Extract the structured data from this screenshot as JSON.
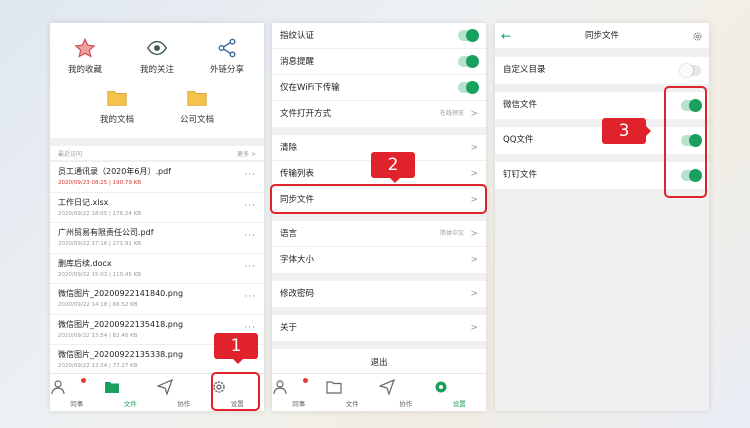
{
  "phone1": {
    "quick_items": [
      {
        "label": "我的收藏",
        "icon": "star-icon"
      },
      {
        "label": "我的关注",
        "icon": "eye-icon"
      },
      {
        "label": "外链分享",
        "icon": "share-icon"
      },
      {
        "label": "我的文档",
        "icon": "folder-icon"
      },
      {
        "label": "公司文档",
        "icon": "folder-icon"
      }
    ],
    "recent_title": "最近访问",
    "more_label": "更多 >",
    "files": [
      {
        "name": "员工通讯录（2020年6月）.pdf",
        "meta": "2020/09/23 08:25 | 190.79 KB",
        "highlight": true
      },
      {
        "name": "工作日记.xlsx",
        "meta": "2020/09/22 18:05 | 176.24 KB",
        "highlight": false
      },
      {
        "name": "广州贸易有限责任公司.pdf",
        "meta": "2020/09/22 17:16 | 271.91 KB",
        "highlight": false
      },
      {
        "name": "删库后续.docx",
        "meta": "2020/09/22 15:03 | 110.45 KB",
        "highlight": false
      },
      {
        "name": "微信图片_20200922141840.png",
        "meta": "2020/09/22 14:18 | 66.52 KB",
        "highlight": false
      },
      {
        "name": "微信图片_20200922135418.png",
        "meta": "2020/09/22 13:54 | 82.46 KB",
        "highlight": false
      },
      {
        "name": "微信图片_20200922135338.png",
        "meta": "2020/09/22 13:54 | 77.27 KB",
        "highlight": false
      }
    ],
    "dots": "···",
    "tabs": [
      "同事",
      "文件",
      "协作",
      "设置"
    ],
    "active_tab": 1
  },
  "phone2": {
    "groups": [
      [
        {
          "label": "指纹认证",
          "type": "toggle",
          "on": true
        },
        {
          "label": "消息提醒",
          "type": "toggle",
          "on": true
        },
        {
          "label": "仅在WiFi下传输",
          "type": "toggle",
          "on": true
        },
        {
          "label": "文件打开方式",
          "type": "link",
          "sub": "在线预览"
        }
      ],
      [
        {
          "label": "清除",
          "type": "link"
        },
        {
          "label": "传输列表",
          "type": "link"
        },
        {
          "label": "同步文件",
          "type": "link"
        }
      ],
      [
        {
          "label": "语言",
          "type": "link",
          "sub": "简体中文"
        },
        {
          "label": "字体大小",
          "type": "link"
        }
      ],
      [
        {
          "label": "修改密码",
          "type": "link"
        }
      ],
      [
        {
          "label": "关于",
          "type": "link"
        }
      ]
    ],
    "logout": "退出",
    "tabs": [
      "同事",
      "文件",
      "协作",
      "设置"
    ],
    "active_tab": 3
  },
  "phone3": {
    "title": "同步文件",
    "rows": [
      {
        "label": "自定义目录",
        "on": false
      },
      {
        "label": "微信文件",
        "on": true
      },
      {
        "label": "QQ文件",
        "on": true
      },
      {
        "label": "钉钉文件",
        "on": true
      }
    ]
  },
  "callouts": {
    "one": "1",
    "two": "2",
    "three": "3"
  },
  "colors": {
    "accent": "#1aa05e",
    "highlight": "#e0232a"
  }
}
